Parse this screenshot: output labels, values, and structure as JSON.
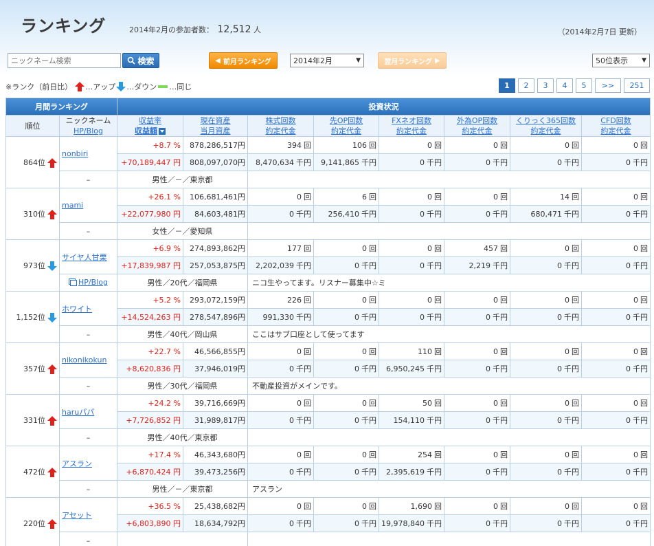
{
  "header": {
    "title": "ランキング",
    "participants_label": "2014年2月の参加者数：",
    "participants_count": "12,512",
    "participants_unit": "人",
    "updated": "（2014年2月7日 更新）"
  },
  "toolbar": {
    "search_placeholder": "ニックネーム検索",
    "search_button": "検索",
    "prev_button": "前月ランキング",
    "month_value": "2014年2月",
    "next_button": "翌月ランキング",
    "per_page_value": "50位表示"
  },
  "legend": {
    "prefix": "※ランク（前日比）",
    "up": "…アップ",
    "down": "…ダウン",
    "same": "…同じ"
  },
  "pager": [
    "1",
    "2",
    "3",
    "4",
    "5",
    ">>",
    "251"
  ],
  "table": {
    "group_monthly": "月間ランキング",
    "group_invest": "投資状況",
    "col_rank": "順位",
    "col_nickname": "ニックネーム",
    "col_hpblog": "HP/Blog",
    "col_return": "収益率",
    "col_return_amt": "収益額",
    "col_assets": "現在資産",
    "col_assets2": "当月資産",
    "col_stock": "株式回数",
    "col_stock2": "約定代金",
    "col_futures": "先OP回数",
    "col_futures2": "約定代金",
    "col_fx": "FXネオ回数",
    "col_fx2": "約定代金",
    "col_fxop": "外為OP回数",
    "col_fxop2": "約定代金",
    "col_click": "くりっく365回数",
    "col_click2": "約定代金",
    "col_cfd": "CFD回数",
    "col_cfd2": "約定代金",
    "unit_count": "回",
    "unit_amount": "千円",
    "rows": [
      {
        "rank": "864位",
        "trend": "up",
        "name": "nonbiri",
        "hp": "",
        "rate": "+8.7 %",
        "profit": "+70,189,447 円",
        "asset1": "878,286,517円",
        "asset2": "808,097,070円",
        "c": [
          "394",
          "106",
          "0",
          "0",
          "0",
          "0"
        ],
        "a": [
          "8,470,634",
          "9,141,865",
          "0",
          "0",
          "0",
          "0"
        ],
        "profile": "男性／－／東京都",
        "comment": ""
      },
      {
        "rank": "310位",
        "trend": "up",
        "name": "mami",
        "hp": "",
        "rate": "+26.1 %",
        "profit": "+22,077,980 円",
        "asset1": "106,681,461円",
        "asset2": "84,603,481円",
        "c": [
          "0",
          "6",
          "0",
          "0",
          "14",
          "0"
        ],
        "a": [
          "0",
          "256,410",
          "0",
          "0",
          "680,471",
          "0"
        ],
        "profile": "女性／－／愛知県",
        "comment": ""
      },
      {
        "rank": "973位",
        "trend": "down",
        "name": "サイヤ人甘栗",
        "hp": "HP/Blog",
        "rate": "+6.9 %",
        "profit": "+17,839,987 円",
        "asset1": "274,893,862円",
        "asset2": "257,053,875円",
        "c": [
          "177",
          "0",
          "0",
          "457",
          "0",
          "0"
        ],
        "a": [
          "2,202,039",
          "0",
          "0",
          "2,219",
          "0",
          "0"
        ],
        "profile": "男性／20代／福岡県",
        "comment": "ニコ生やってます。リスナー募集中☆ミ"
      },
      {
        "rank": "1,152位",
        "trend": "down",
        "name": "ホワイト",
        "hp": "",
        "rate": "+5.2 %",
        "profit": "+14,524,263 円",
        "asset1": "293,072,159円",
        "asset2": "278,547,896円",
        "c": [
          "226",
          "0",
          "0",
          "0",
          "0",
          "0"
        ],
        "a": [
          "991,330",
          "0",
          "0",
          "0",
          "0",
          "0"
        ],
        "profile": "男性／40代／岡山県",
        "comment": "ここはサブ口座として使ってます"
      },
      {
        "rank": "357位",
        "trend": "up",
        "name": "nikonikokun",
        "hp": "",
        "rate": "+22.7 %",
        "profit": "+8,620,836 円",
        "asset1": "46,566,855円",
        "asset2": "37,946,019円",
        "c": [
          "0",
          "0",
          "110",
          "0",
          "0",
          "0"
        ],
        "a": [
          "0",
          "0",
          "6,950,245",
          "0",
          "0",
          "0"
        ],
        "profile": "男性／30代／福岡県",
        "comment": "不動産投資がメインです。"
      },
      {
        "rank": "331位",
        "trend": "up",
        "name": "haruパパ",
        "hp": "",
        "rate": "+24.2 %",
        "profit": "+7,726,852 円",
        "asset1": "39,716,669円",
        "asset2": "31,989,817円",
        "c": [
          "0",
          "0",
          "50",
          "0",
          "0",
          "0"
        ],
        "a": [
          "0",
          "0",
          "154,110",
          "0",
          "0",
          "0"
        ],
        "profile": "男性／40代／東京都",
        "comment": ""
      },
      {
        "rank": "472位",
        "trend": "up",
        "name": "アスラン",
        "hp": "",
        "rate": "+17.4 %",
        "profit": "+6,870,424 円",
        "asset1": "46,343,680円",
        "asset2": "39,473,256円",
        "c": [
          "0",
          "0",
          "254",
          "0",
          "0",
          "0"
        ],
        "a": [
          "0",
          "0",
          "2,395,619",
          "0",
          "0",
          "0"
        ],
        "profile": "男性／－／東京都",
        "comment": "アスラン"
      },
      {
        "rank": "220位",
        "trend": "up",
        "name": "アセット",
        "hp": "",
        "rate": "+36.5 %",
        "profit": "+6,803,890 円",
        "asset1": "25,438,682円",
        "asset2": "18,634,792円",
        "c": [
          "0",
          "0",
          "1,690",
          "0",
          "0",
          "0"
        ],
        "a": [
          "0",
          "0",
          "19,978,840",
          "0",
          "0",
          "0"
        ],
        "profile": "",
        "comment": ""
      }
    ]
  },
  "colors": {
    "accent": "#2a70b8",
    "up": "#e0201a",
    "down": "#2a9ae0",
    "same": "#7ed957"
  }
}
